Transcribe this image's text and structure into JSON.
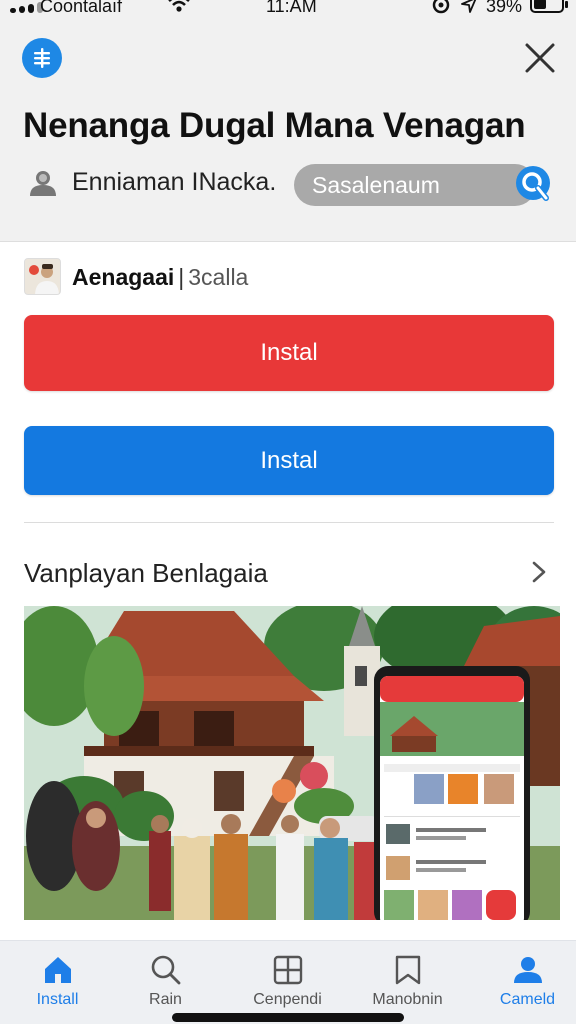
{
  "status_bar": {
    "carrier": "Coontalaıf",
    "time": "11:AM",
    "battery": "39%"
  },
  "header": {
    "menu_icon": "menu-icon",
    "close_icon": "close-icon",
    "title": "Nenanga Dugal Mana Venagan"
  },
  "user": {
    "icon": "person-icon",
    "name": "Enniaman INacka."
  },
  "search": {
    "placeholder": "Sasalenaum",
    "icon": "search-icon"
  },
  "app": {
    "name": "Aenagaai",
    "separator": "|",
    "meta": "3calla"
  },
  "buttons": {
    "primary_red": "Instal",
    "primary_blue": "Instal"
  },
  "section": {
    "title": "Vanplayan Benlagaia",
    "chevron": "chevron-right-icon"
  },
  "colors": {
    "accent_blue": "#1479e0",
    "accent_red": "#e83838",
    "nav_active": "#1e7ee8"
  },
  "bottom_nav": {
    "items": [
      {
        "label": "Install",
        "icon": "home-icon",
        "active": true
      },
      {
        "label": "Rain",
        "icon": "search-icon",
        "active": false
      },
      {
        "label": "Cenpendi",
        "icon": "grid-icon",
        "active": false
      },
      {
        "label": "Manobnin",
        "icon": "bookmark-icon",
        "active": false
      },
      {
        "label": "Cameld",
        "icon": "profile-icon",
        "active": true
      }
    ]
  }
}
